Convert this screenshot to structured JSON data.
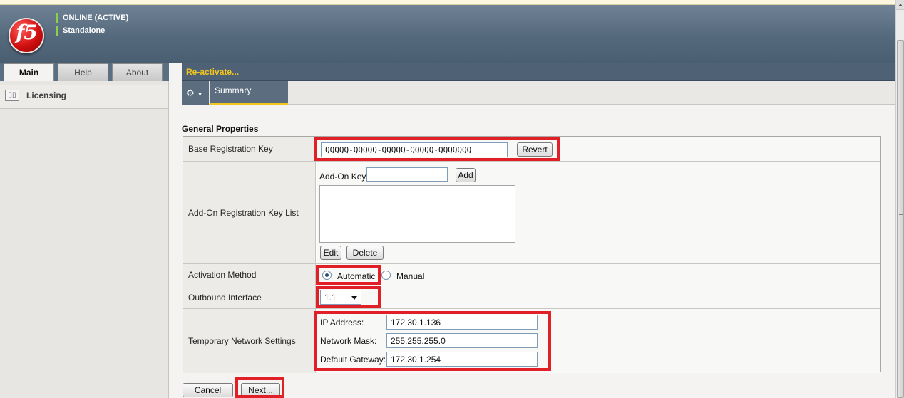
{
  "header": {
    "logo_text": "f5",
    "status_line1": "ONLINE (ACTIVE)",
    "status_line2": "Standalone",
    "status_color": "#8bd24a"
  },
  "main_tabs": [
    {
      "label": "Main",
      "active": true
    },
    {
      "label": "Help",
      "active": false
    },
    {
      "label": "About",
      "active": false
    }
  ],
  "sidebar": {
    "items": [
      {
        "label": "Licensing",
        "icon": "license-icon"
      }
    ]
  },
  "panel": {
    "title": "Re-activate...",
    "gear_icon": "gear-icon",
    "tab_summary": "Summary",
    "section_title": "General Properties"
  },
  "form": {
    "base_key_label": "Base Registration Key",
    "base_key_value": "QQQQQ-QQQQQ-QQQQQ-QQQQQ-QQQQQQQ",
    "revert_label": "Revert",
    "addon_list_label": "Add-On Registration Key List",
    "addon_key_label": "Add-On Key",
    "addon_key_value": "",
    "add_label": "Add",
    "edit_label": "Edit",
    "delete_label": "Delete",
    "activation_label": "Activation Method",
    "activation_options": [
      "Automatic",
      "Manual"
    ],
    "activation_selected": "Automatic",
    "outbound_label": "Outbound Interface",
    "outbound_value": "1.1",
    "temp_net_label": "Temporary Network Settings",
    "ip_label": "IP Address:",
    "ip_value": "172.30.1.136",
    "mask_label": "Network Mask:",
    "mask_value": "255.255.255.0",
    "gateway_label": "Default Gateway:",
    "gateway_value": "172.30.1.254"
  },
  "footer": {
    "cancel_label": "Cancel",
    "next_label": "Next..."
  },
  "colors": {
    "highlight": "#e01f26",
    "accent_yellow": "#f2c51d",
    "header_blue": "#55697d"
  }
}
